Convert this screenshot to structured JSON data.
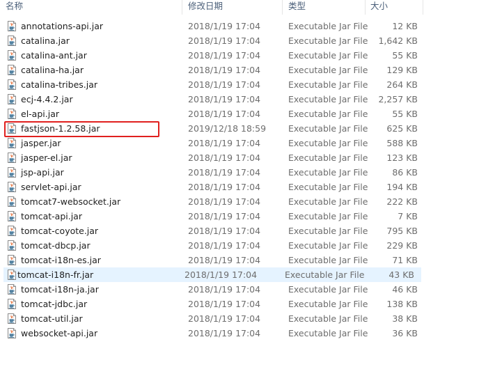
{
  "columns": {
    "name": "名称",
    "date": "修改日期",
    "type": "类型",
    "size": "大小"
  },
  "files": [
    {
      "name": "annotations-api.jar",
      "date": "2018/1/19 17:04",
      "type": "Executable Jar File",
      "size": "12 KB"
    },
    {
      "name": "catalina.jar",
      "date": "2018/1/19 17:04",
      "type": "Executable Jar File",
      "size": "1,642 KB"
    },
    {
      "name": "catalina-ant.jar",
      "date": "2018/1/19 17:04",
      "type": "Executable Jar File",
      "size": "55 KB"
    },
    {
      "name": "catalina-ha.jar",
      "date": "2018/1/19 17:04",
      "type": "Executable Jar File",
      "size": "129 KB"
    },
    {
      "name": "catalina-tribes.jar",
      "date": "2018/1/19 17:04",
      "type": "Executable Jar File",
      "size": "264 KB"
    },
    {
      "name": "ecj-4.4.2.jar",
      "date": "2018/1/19 17:04",
      "type": "Executable Jar File",
      "size": "2,257 KB"
    },
    {
      "name": "el-api.jar",
      "date": "2018/1/19 17:04",
      "type": "Executable Jar File",
      "size": "55 KB"
    },
    {
      "name": "fastjson-1.2.58.jar",
      "date": "2019/12/18 18:59",
      "type": "Executable Jar File",
      "size": "625 KB"
    },
    {
      "name": "jasper.jar",
      "date": "2018/1/19 17:04",
      "type": "Executable Jar File",
      "size": "588 KB"
    },
    {
      "name": "jasper-el.jar",
      "date": "2018/1/19 17:04",
      "type": "Executable Jar File",
      "size": "123 KB"
    },
    {
      "name": "jsp-api.jar",
      "date": "2018/1/19 17:04",
      "type": "Executable Jar File",
      "size": "86 KB"
    },
    {
      "name": "servlet-api.jar",
      "date": "2018/1/19 17:04",
      "type": "Executable Jar File",
      "size": "194 KB"
    },
    {
      "name": "tomcat7-websocket.jar",
      "date": "2018/1/19 17:04",
      "type": "Executable Jar File",
      "size": "222 KB"
    },
    {
      "name": "tomcat-api.jar",
      "date": "2018/1/19 17:04",
      "type": "Executable Jar File",
      "size": "7 KB"
    },
    {
      "name": "tomcat-coyote.jar",
      "date": "2018/1/19 17:04",
      "type": "Executable Jar File",
      "size": "795 KB"
    },
    {
      "name": "tomcat-dbcp.jar",
      "date": "2018/1/19 17:04",
      "type": "Executable Jar File",
      "size": "229 KB"
    },
    {
      "name": "tomcat-i18n-es.jar",
      "date": "2018/1/19 17:04",
      "type": "Executable Jar File",
      "size": "71 KB"
    },
    {
      "name": "tomcat-i18n-fr.jar",
      "date": "2018/1/19 17:04",
      "type": "Executable Jar File",
      "size": "43 KB"
    },
    {
      "name": "tomcat-i18n-ja.jar",
      "date": "2018/1/19 17:04",
      "type": "Executable Jar File",
      "size": "46 KB"
    },
    {
      "name": "tomcat-jdbc.jar",
      "date": "2018/1/19 17:04",
      "type": "Executable Jar File",
      "size": "138 KB"
    },
    {
      "name": "tomcat-util.jar",
      "date": "2018/1/19 17:04",
      "type": "Executable Jar File",
      "size": "38 KB"
    },
    {
      "name": "websocket-api.jar",
      "date": "2018/1/19 17:04",
      "type": "Executable Jar File",
      "size": "36 KB"
    }
  ],
  "file_icon": "java-jar-file-icon",
  "hovered_file": "tomcat-i18n-fr.jar",
  "highlighted_file": "fastjson-1.2.58.jar",
  "highlight_color": "#e0201e",
  "hover_color": "#e5f3ff"
}
